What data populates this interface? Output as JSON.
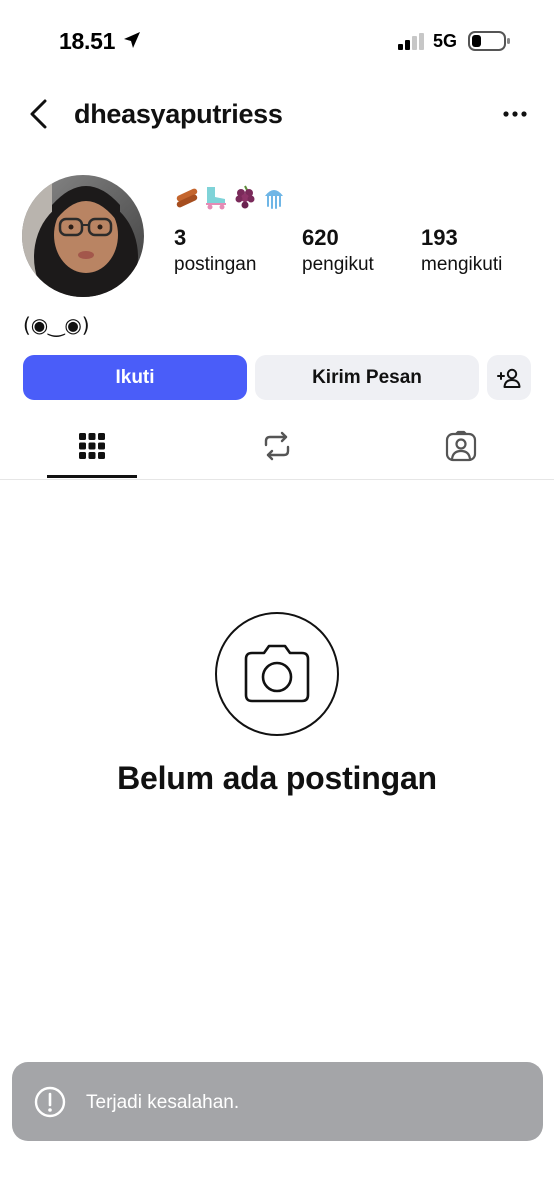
{
  "status_bar": {
    "time": "18.51",
    "network": "5G",
    "icons": [
      "location-arrow-icon",
      "signal-icon",
      "battery-icon"
    ]
  },
  "header": {
    "username": "dheasyaputriess",
    "icons": [
      "chevron-left-icon",
      "more-horizontal-icon"
    ]
  },
  "profile": {
    "emojis": [
      "sausage-emoji",
      "roller-skate-emoji",
      "grapes-emoji",
      "jellyfish-emoji"
    ],
    "stats": [
      {
        "value": "3",
        "label": "postingan"
      },
      {
        "value": "620",
        "label": "pengikut"
      },
      {
        "value": "193",
        "label": "mengikuti"
      }
    ],
    "bio": "(◉‿◉)"
  },
  "actions": {
    "follow_label": "Ikuti",
    "message_label": "Kirim Pesan",
    "add_user_icon": "add-user-icon"
  },
  "tabs": [
    {
      "icon": "grid-icon",
      "active": true
    },
    {
      "icon": "repost-icon",
      "active": false
    },
    {
      "icon": "tagged-user-icon",
      "active": false
    }
  ],
  "empty_state": {
    "icon": "camera-icon",
    "title": "Belum ada postingan"
  },
  "toast": {
    "icon": "alert-circle-icon",
    "message": "Terjadi kesalahan."
  },
  "colors": {
    "accent": "#4a5df9",
    "secondary_button": "#eff0f4",
    "toast_bg": "#a4a5a8"
  }
}
